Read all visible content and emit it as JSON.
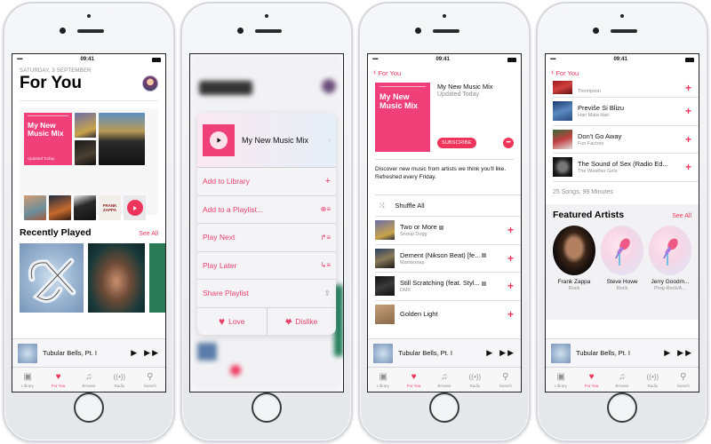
{
  "status_bar": {
    "time": "09:41",
    "signal": "•••••",
    "wifi": "wifi-icon",
    "battery": "battery-icon"
  },
  "tabbar": {
    "items": [
      {
        "label": "Library",
        "icon": "library-icon"
      },
      {
        "label": "For You",
        "icon": "heart-icon"
      },
      {
        "label": "Browse",
        "icon": "music-note-icon"
      },
      {
        "label": "Radio",
        "icon": "radio-icon"
      },
      {
        "label": "Search",
        "icon": "search-icon"
      }
    ],
    "active": "For You"
  },
  "mini_player": {
    "title": "Tubular Bells, Pt. I",
    "play": "▶",
    "next": "▶▶"
  },
  "screen1": {
    "date": "SATURDAY, 3 SEPTEMBER",
    "title": "For You",
    "mix": {
      "title": "My New Music Mix",
      "subtitle": "Updated Today",
      "tile_text": "FRANK ZAPPA"
    },
    "recently_played": {
      "heading": "Recently Played",
      "see_all": "See All"
    }
  },
  "screen2": {
    "popup": {
      "title": "My New Music Mix",
      "actions": [
        {
          "label": "Add to Library",
          "icon": "plus-icon",
          "glyph": "+"
        },
        {
          "label": "Add to a Playlist...",
          "icon": "add-playlist-icon",
          "glyph": "⊕≡"
        },
        {
          "label": "Play Next",
          "icon": "play-next-icon",
          "glyph": "↱≡"
        },
        {
          "label": "Play Later",
          "icon": "play-later-icon",
          "glyph": "↳≡"
        },
        {
          "label": "Share Playlist",
          "icon": "share-icon",
          "glyph": "⇪"
        }
      ],
      "love": "Love",
      "dislike": "Dislike"
    }
  },
  "screen3": {
    "back": "For You",
    "playlist": {
      "title": "My New Music Mix",
      "updated": "Updated Today",
      "subscribe": "SUBSCRIBE",
      "more": "•••",
      "description": "Discover new music from artists we think you'll like. Refreshed every Friday."
    },
    "shuffle": "Shuffle All",
    "songs": [
      {
        "title": "Two or More",
        "artist": "Snoop Dogg",
        "explicit": true
      },
      {
        "title": "Dement (Nikson Beat) [fe...",
        "artist": "Mambonap",
        "explicit": true
      },
      {
        "title": "Still Scratching (feat. Styl...",
        "artist": "DMX",
        "explicit": true
      },
      {
        "title": "Golden Light",
        "artist": "",
        "explicit": false
      }
    ]
  },
  "screen4": {
    "back": "For You",
    "songs": [
      {
        "title": "",
        "artist": "Thompson"
      },
      {
        "title": "Previše Si Blizu",
        "artist": "Hari Mata Hari"
      },
      {
        "title": "Don't Go Away",
        "artist": "Fun Factory"
      },
      {
        "title": "The Sound of Sex (Radio Ed...",
        "artist": "The Weather Girls"
      }
    ],
    "summary": "25 Songs, 99 Minutes",
    "featured": {
      "heading": "Featured Artists",
      "see_all": "See All",
      "artists": [
        {
          "name": "Frank Zappa",
          "genre": "Rock"
        },
        {
          "name": "Steve Howe",
          "genre": "Rock"
        },
        {
          "name": "Jerry Goodm...",
          "genre": "Prog-Rock/A..."
        }
      ]
    }
  },
  "colors": {
    "accent": "#f0355d",
    "mix_pink": "#f0407a",
    "secondary_text": "#8e8e93"
  }
}
